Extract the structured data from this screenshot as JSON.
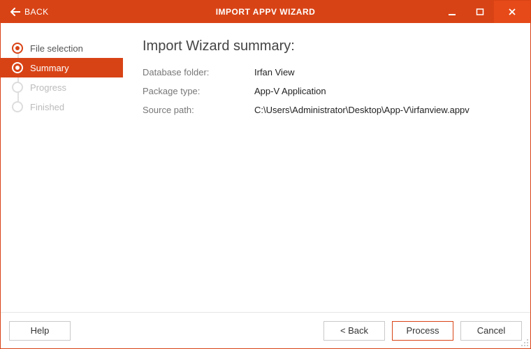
{
  "titlebar": {
    "back_label": "BACK",
    "title": "IMPORT APPV WIZARD"
  },
  "sidebar": {
    "steps": [
      {
        "label": "File selection",
        "state": "done"
      },
      {
        "label": "Summary",
        "state": "active"
      },
      {
        "label": "Progress",
        "state": "pending"
      },
      {
        "label": "Finished",
        "state": "pending"
      }
    ]
  },
  "main": {
    "heading": "Import Wizard summary:",
    "rows": [
      {
        "k": "Database folder:",
        "v": "Irfan View"
      },
      {
        "k": "Package type:",
        "v": "App-V Application"
      },
      {
        "k": "Source path:",
        "v": "C:\\Users\\Administrator\\Desktop\\App-V\\irfanview.appv"
      }
    ]
  },
  "footer": {
    "help": "Help",
    "back": "< Back",
    "process": "Process",
    "cancel": "Cancel"
  }
}
